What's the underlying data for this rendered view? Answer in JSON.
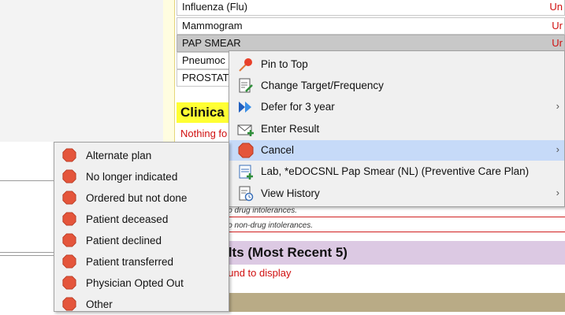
{
  "care_list": {
    "rows": [
      {
        "name": "Influenza (Flu)",
        "status": "Un"
      },
      {
        "name": "Mammogram",
        "status": "Ur"
      },
      {
        "name": "PAP SMEAR",
        "status": "Ur"
      },
      {
        "name": "Pneumoc",
        "status": ""
      },
      {
        "name": "PROSTAT",
        "status": ""
      }
    ]
  },
  "clinical": {
    "header": "Clinica",
    "empty_text": "Nothing fo"
  },
  "allergies": {
    "drug": "No drug intolerances.",
    "non_drug": "No non-drug intolerances."
  },
  "results": {
    "header": "sults (Most Recent 5)",
    "empty_text": "ound to display"
  },
  "context_menu": {
    "items": [
      {
        "label": "Pin to Top",
        "icon": "pin-icon",
        "submenu": false
      },
      {
        "label": "Change Target/Frequency",
        "icon": "edit-document-icon",
        "submenu": false
      },
      {
        "label": "Defer for 3 year",
        "icon": "fast-forward-icon",
        "submenu": true
      },
      {
        "label": "Enter Result",
        "icon": "envelope-add-icon",
        "submenu": false
      },
      {
        "label": "Cancel",
        "icon": "stop-icon",
        "submenu": true
      },
      {
        "label": "Lab, *eDOCSNL Pap Smear (NL) (Preventive Care Plan)",
        "icon": "lab-order-icon",
        "submenu": false
      },
      {
        "label": "View History",
        "icon": "history-document-icon",
        "submenu": true
      }
    ],
    "arrow": "›",
    "highlight_color": "#c6daf8"
  },
  "cancel_submenu": {
    "items": [
      {
        "label": "Alternate plan"
      },
      {
        "label": "No longer indicated"
      },
      {
        "label": "Ordered but not done"
      },
      {
        "label": "Patient deceased"
      },
      {
        "label": "Patient declined"
      },
      {
        "label": "Patient transferred"
      },
      {
        "label": "Physician Opted Out"
      },
      {
        "label": "Other"
      }
    ],
    "icon": "stop-icon",
    "icon_color": "#e4553b"
  }
}
